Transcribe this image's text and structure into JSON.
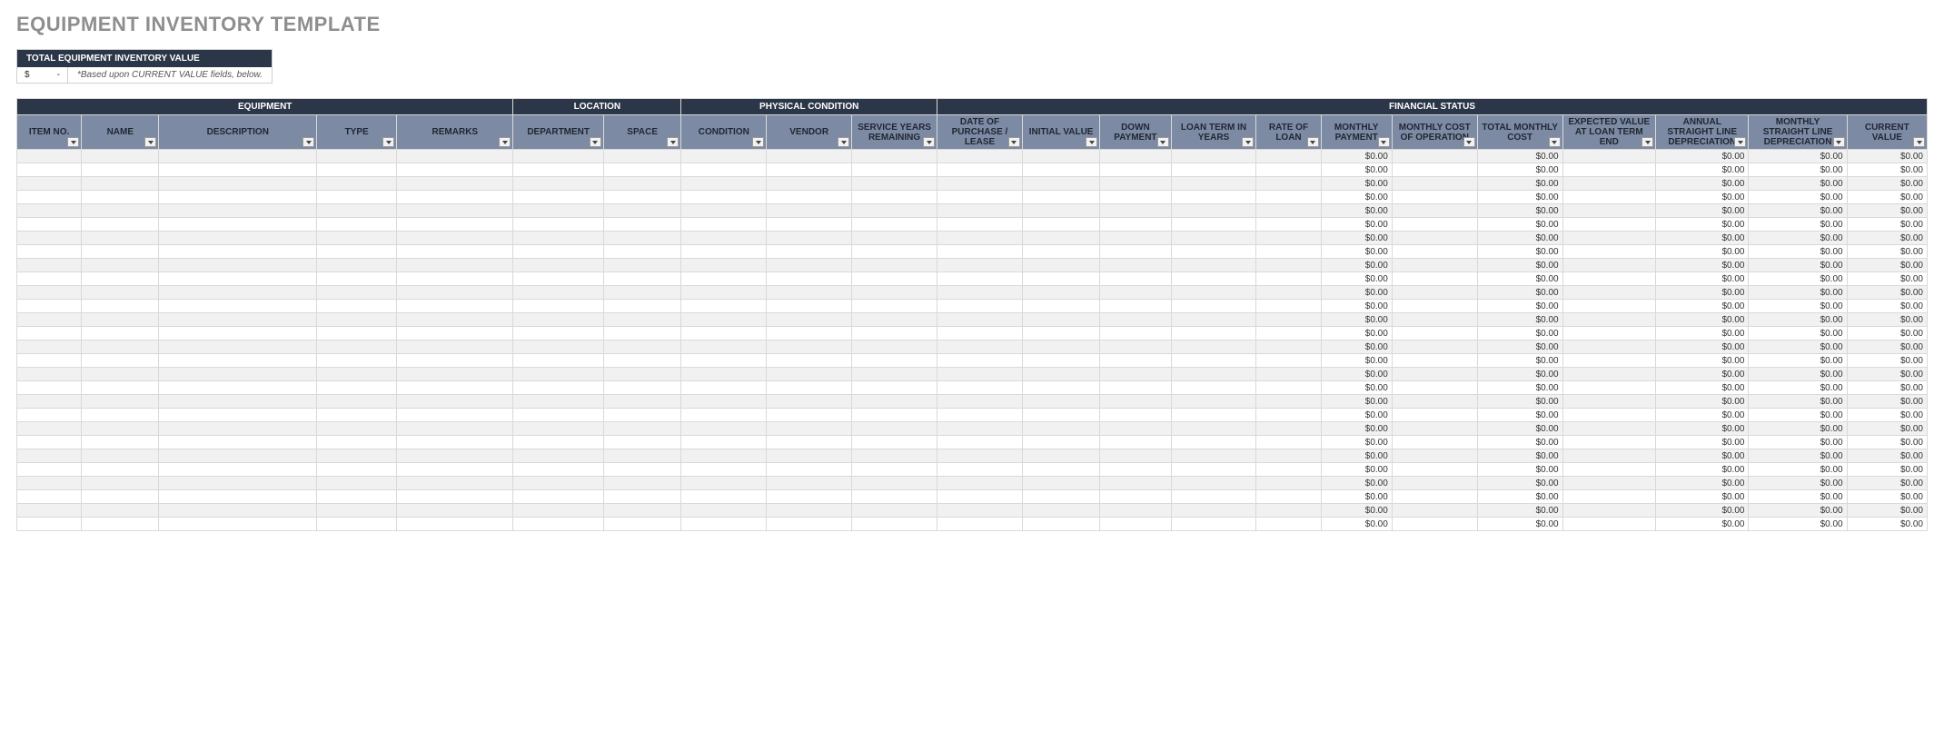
{
  "title": "EQUIPMENT INVENTORY TEMPLATE",
  "summary": {
    "header": "TOTAL EQUIPMENT INVENTORY VALUE",
    "currency": "$",
    "value": "-",
    "note": "*Based upon CURRENT VALUE fields, below."
  },
  "groups": [
    {
      "label": "EQUIPMENT",
      "span": 5
    },
    {
      "label": "LOCATION",
      "span": 2
    },
    {
      "label": "PHYSICAL CONDITION",
      "span": 3
    },
    {
      "label": "FINANCIAL STATUS",
      "span": 12
    }
  ],
  "columns": [
    {
      "label": "ITEM NO.",
      "cls": "c-itemno"
    },
    {
      "label": "NAME",
      "cls": "c-name"
    },
    {
      "label": "DESCRIPTION",
      "cls": "c-desc"
    },
    {
      "label": "TYPE",
      "cls": "c-type"
    },
    {
      "label": "REMARKS",
      "cls": "c-remarks"
    },
    {
      "label": "DEPARTMENT",
      "cls": "c-dept"
    },
    {
      "label": "SPACE",
      "cls": "c-space"
    },
    {
      "label": "CONDITION",
      "cls": "c-cond"
    },
    {
      "label": "VENDOR",
      "cls": "c-vendor"
    },
    {
      "label": "SERVICE YEARS REMAINING",
      "cls": "c-syr"
    },
    {
      "label": "DATE OF PURCHASE / LEASE",
      "cls": "c-date"
    },
    {
      "label": "INITIAL VALUE",
      "cls": "c-ival"
    },
    {
      "label": "DOWN PAYMENT",
      "cls": "c-down"
    },
    {
      "label": "LOAN TERM IN YEARS",
      "cls": "c-loanterm"
    },
    {
      "label": "RATE OF LOAN",
      "cls": "c-rate"
    },
    {
      "label": "MONTHLY PAYMENT",
      "cls": "c-mpay"
    },
    {
      "label": "MONTHLY COST OF OPERATION",
      "cls": "c-mop"
    },
    {
      "label": "TOTAL MONTHLY COST",
      "cls": "c-tmc"
    },
    {
      "label": "EXPECTED VALUE AT LOAN TERM END",
      "cls": "c-exp"
    },
    {
      "label": "ANNUAL STRAIGHT LINE DEPRECIATION",
      "cls": "c-asl"
    },
    {
      "label": "MONTHLY STRAIGHT LINE DEPRECIATION",
      "cls": "c-msl"
    },
    {
      "label": "CURRENT VALUE",
      "cls": "c-cur"
    }
  ],
  "default_cell": "$0.00",
  "calculated_columns": [
    15,
    17,
    19,
    20,
    21
  ],
  "row_count": 28
}
